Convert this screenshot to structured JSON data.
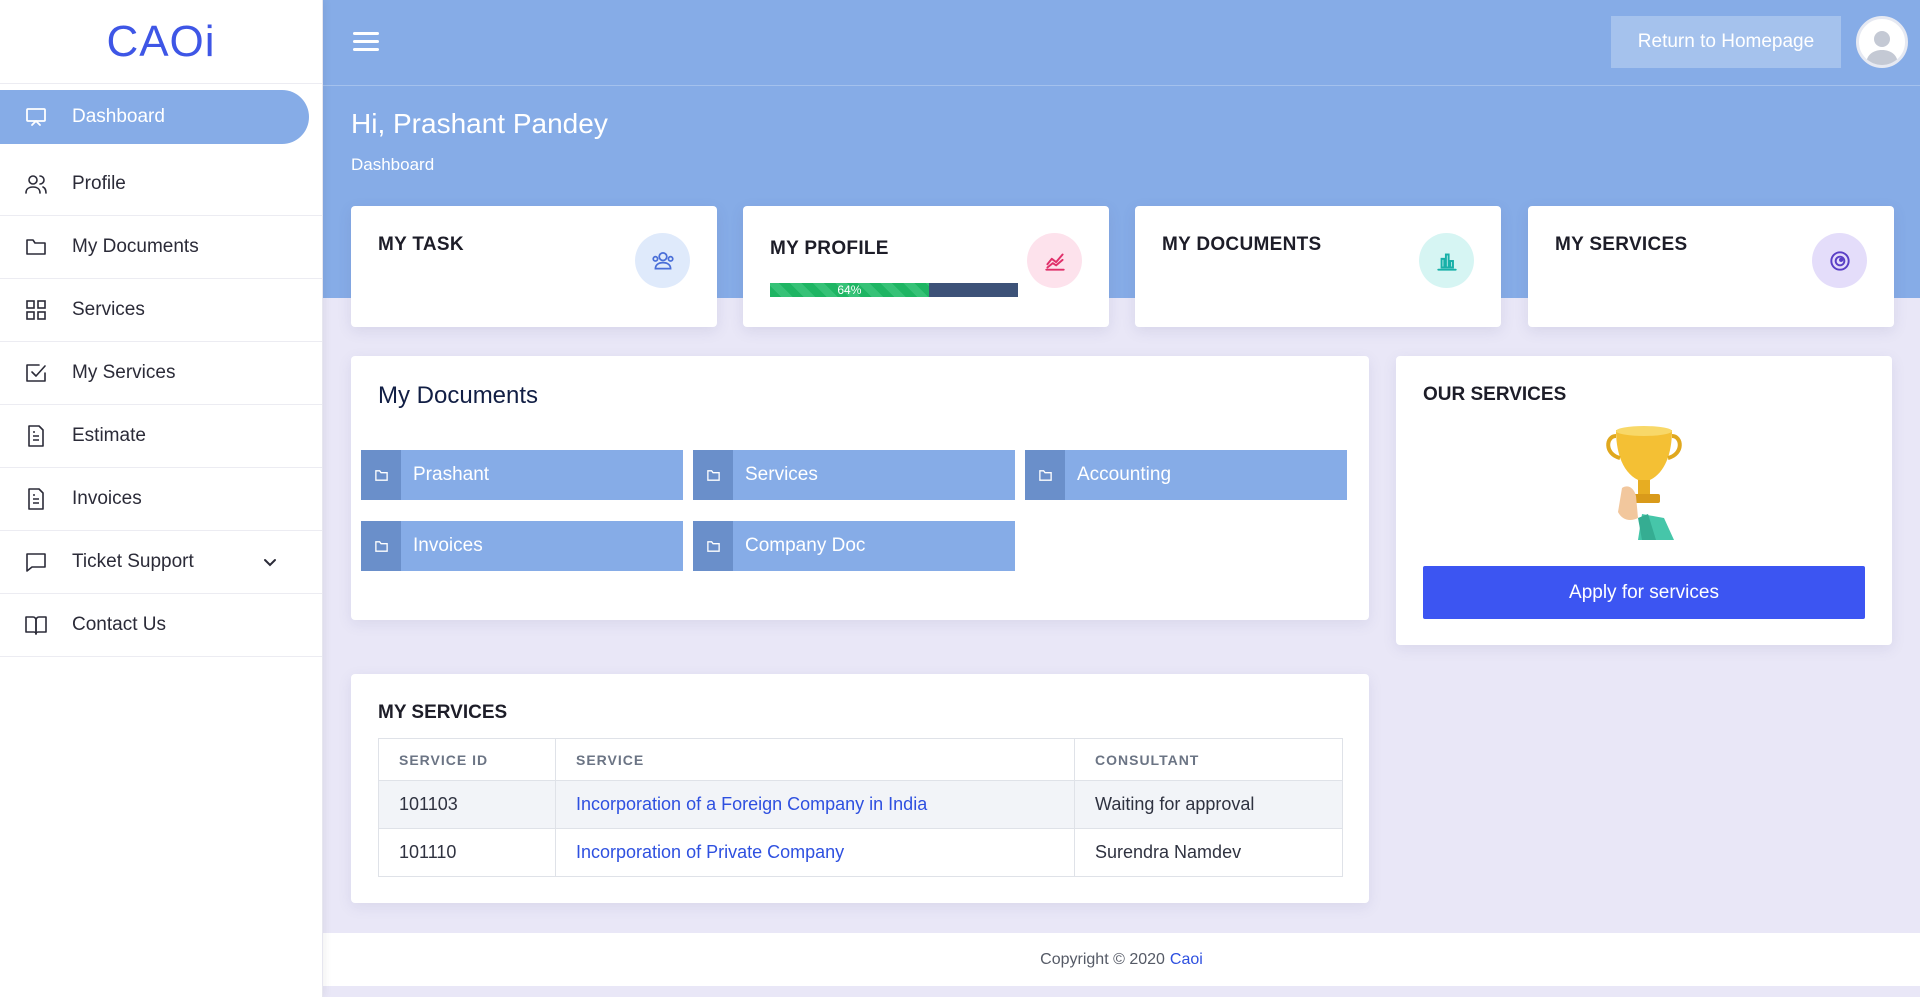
{
  "brand": {
    "logo": "CAOi"
  },
  "sidebar": {
    "items": [
      {
        "label": "Dashboard",
        "icon": "monitor-icon"
      },
      {
        "label": "Profile",
        "icon": "users-icon"
      },
      {
        "label": "My Documents",
        "icon": "folder-icon"
      },
      {
        "label": "Services",
        "icon": "grid-icon"
      },
      {
        "label": "My Services",
        "icon": "check-square-icon"
      },
      {
        "label": "Estimate",
        "icon": "file-text-icon"
      },
      {
        "label": "Invoices",
        "icon": "file-text-icon"
      },
      {
        "label": "Ticket Support",
        "icon": "message-square-icon"
      },
      {
        "label": "Contact Us",
        "icon": "book-open-icon"
      }
    ]
  },
  "header": {
    "return_label": "Return to Homepage",
    "greeting": "Hi, Prashant Pandey",
    "breadcrumb": "Dashboard"
  },
  "stats": {
    "task": "MY TASK",
    "profile": "MY PROFILE",
    "profile_progress": 64,
    "profile_progress_label": "64%",
    "documents": "MY DOCUMENTS",
    "services": "MY SERVICES"
  },
  "documents": {
    "title": "My Documents",
    "folders": [
      "Prashant",
      "Services",
      "Accounting",
      "Invoices",
      "Company Doc"
    ]
  },
  "our_services": {
    "title": "OUR SERVICES",
    "apply_label": "Apply for services"
  },
  "my_services": {
    "title": "MY SERVICES",
    "columns": [
      "SERVICE ID",
      "SERVICE",
      "CONSULTANT"
    ],
    "rows": [
      {
        "id": "101103",
        "service": "Incorporation of a Foreign Company in India",
        "consultant": "Waiting for approval"
      },
      {
        "id": "101110",
        "service": "Incorporation of Private Company",
        "consultant": "Surendra Namdev"
      }
    ]
  },
  "footer": {
    "text": "Copyright © 2020",
    "link": "Caoi"
  },
  "colors": {
    "primary": "#86ace7",
    "accent": "#3c55f2",
    "link": "#2e50e0"
  }
}
